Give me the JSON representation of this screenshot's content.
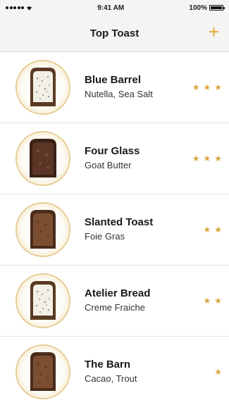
{
  "status": {
    "time": "9:41 AM",
    "battery": "100%"
  },
  "nav": {
    "title": "Top Toast",
    "add_label": "+"
  },
  "toasts": [
    {
      "name": "Blue Barrel",
      "topping": "Nutella, Sea Salt",
      "rating": 3,
      "image": "toast-with-spread"
    },
    {
      "name": "Four Glass",
      "topping": "Goat Butter",
      "rating": 3,
      "image": "dark-toast"
    },
    {
      "name": "Slanted Toast",
      "topping": "Foie Gras",
      "rating": 2,
      "image": "plain-toast"
    },
    {
      "name": "Atelier Bread",
      "topping": "Creme Fraiche",
      "rating": 2,
      "image": "toast-with-spread"
    },
    {
      "name": "The Barn",
      "topping": "Cacao, Trout",
      "rating": 1,
      "image": "plain-toast"
    }
  ],
  "colors": {
    "accent": "#e6a82c",
    "star": "#d9a640"
  }
}
